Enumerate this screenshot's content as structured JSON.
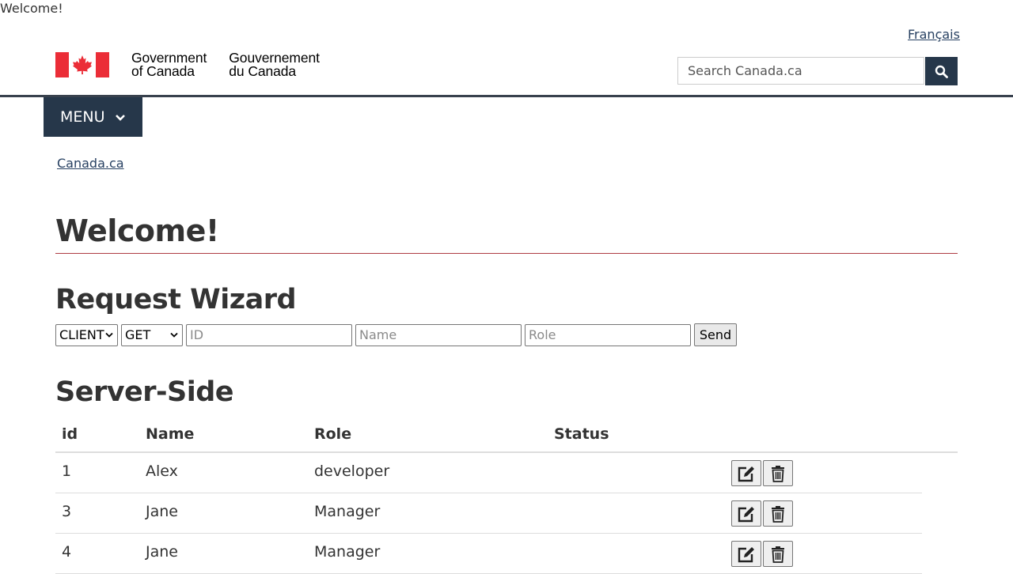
{
  "top_text": "Welcome!",
  "header": {
    "language_link": "Français",
    "signature_en": [
      "Government",
      "of Canada"
    ],
    "signature_fr": [
      "Gouvernement",
      "du Canada"
    ],
    "search": {
      "placeholder": "Search Canada.ca"
    },
    "menu_label": "MENU"
  },
  "breadcrumb": [
    "Canada.ca"
  ],
  "page_title": "Welcome!",
  "wizard": {
    "title": "Request Wizard",
    "target_select": "CLIENT",
    "method_select": "GET",
    "id_placeholder": "ID",
    "name_placeholder": "Name",
    "role_placeholder": "Role",
    "send_label": "Send"
  },
  "server": {
    "title": "Server-Side",
    "columns": [
      "id",
      "Name",
      "Role",
      "Status"
    ],
    "rows": [
      {
        "id": "1",
        "name": "Alex",
        "role": "developer",
        "status": ""
      },
      {
        "id": "3",
        "name": "Jane",
        "role": "Manager",
        "status": ""
      },
      {
        "id": "4",
        "name": "Jane",
        "role": "Manager",
        "status": ""
      }
    ]
  },
  "colors": {
    "brand_dark": "#26374a",
    "link": "#284162",
    "flag_red": "#eb2d37",
    "title_rule": "#af3c43"
  },
  "icons": [
    "search-icon",
    "chevron-down-icon",
    "edit-icon",
    "trash-icon",
    "maple-leaf-icon"
  ]
}
